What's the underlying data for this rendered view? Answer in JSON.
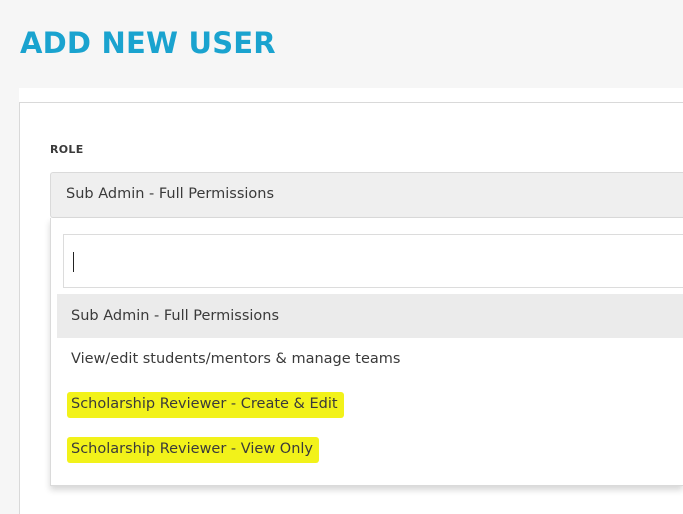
{
  "page": {
    "title": "ADD NEW USER"
  },
  "form": {
    "role_label": "ROLE",
    "role_selected": "Sub Admin - Full Permissions"
  },
  "dropdown": {
    "search_value": "",
    "options": [
      {
        "label": "Sub Admin - Full Permissions",
        "state": "hovered",
        "highlighted": false
      },
      {
        "label": "View/edit students/mentors & manage teams",
        "state": "normal",
        "highlighted": false
      },
      {
        "label": "Scholarship Reviewer - Create & Edit",
        "state": "normal",
        "highlighted": true
      },
      {
        "label": "Scholarship Reviewer - View Only",
        "state": "normal",
        "highlighted": true
      }
    ]
  },
  "colors": {
    "title": "#1aa3cf",
    "highlight": "#f2f21a",
    "select_bg": "#efefef",
    "active_option_bg": "#ebebeb"
  }
}
